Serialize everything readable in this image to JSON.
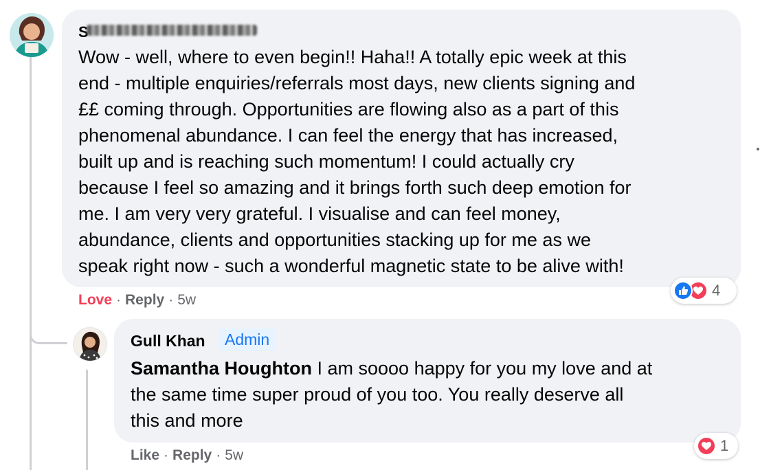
{
  "comment": {
    "author_blurred": "S",
    "text": "Wow - well, where to even begin!! Haha!! A totally epic week at this\nend - multiple enquiries/referrals most days, new clients signing and\n££ coming through. Opportunities are flowing also as a part of this\nphenomenal abundance. I can feel the energy that has increased,\nbuilt up and is reaching such momentum! I could actually cry\nbecause I feel so amazing and it brings forth such deep emotion for\nme. I am very very grateful. I visualise and can feel money,\nabundance, clients and opportunities stacking up for me as we\nspeak right now - such a wonderful magnetic state to be alive with!",
    "actions": {
      "love": "Love",
      "reply": "Reply",
      "time": "5w"
    },
    "reactions": {
      "icons": [
        "like-icon",
        "love-icon"
      ],
      "count": "4"
    }
  },
  "reply": {
    "author": "Gull Khan",
    "badge": "Admin",
    "mention": "Samantha Houghton",
    "text_first": " I am soooo happy for you my love and at",
    "text_rest": "the same time super proud of you too. You really deserve all\nthis and more",
    "actions": {
      "like": "Like",
      "reply": "Reply",
      "time": "5w"
    },
    "reactions": {
      "icons": [
        "love-icon"
      ],
      "count": "1"
    }
  },
  "colors": {
    "bubble": "#f0f2f5",
    "love": "#f33e58",
    "like": "#1877f2",
    "admin_bg": "#e7f3ff",
    "muted": "#65676b"
  }
}
